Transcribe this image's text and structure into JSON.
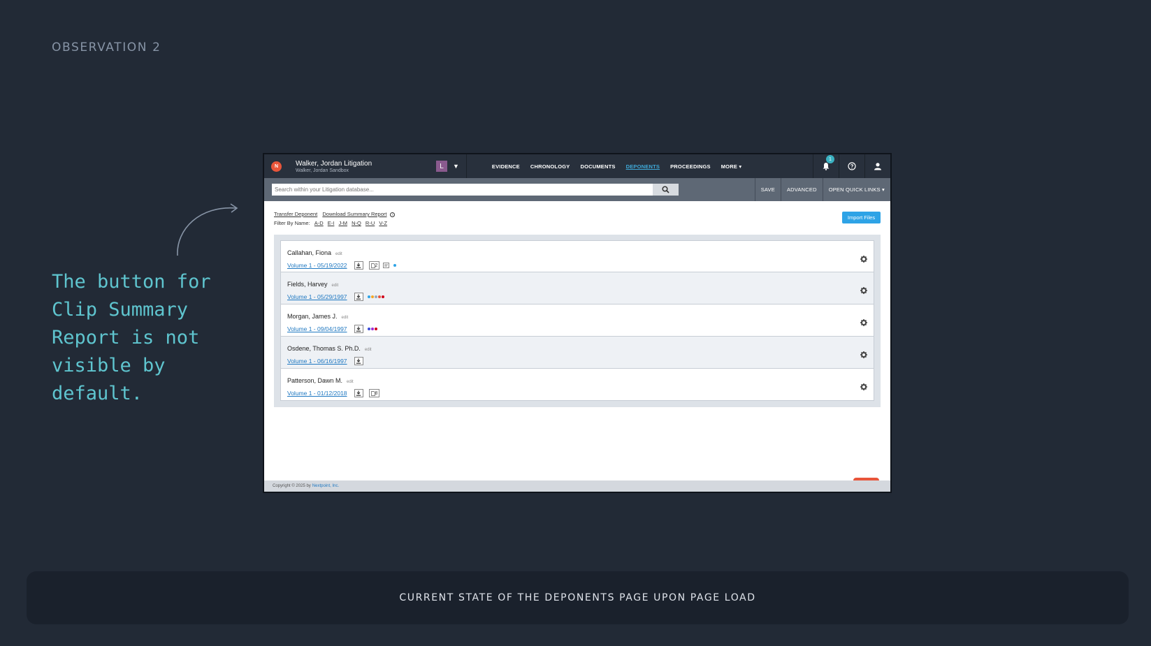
{
  "slide": {
    "observation_label": "OBSERVATION 2",
    "note": "The button for Clip Summary Report is not visible by default.",
    "caption": "CURRENT STATE OF THE DEPONENTS PAGE UPON PAGE LOAD"
  },
  "app": {
    "logo_text": "N",
    "case_title": "Walker, Jordan Litigation",
    "case_subtitle": "Walker, Jordan Sandbox",
    "badge": "L",
    "nav": [
      "EVIDENCE",
      "CHRONOLOGY",
      "DOCUMENTS",
      "DEPONENTS",
      "PROCEEDINGS",
      "MORE ▾"
    ],
    "active_nav": "DEPONENTS",
    "notification_count": "1",
    "search_placeholder": "Search within your Litigation database...",
    "search_actions": [
      "SAVE",
      "ADVANCED",
      "OPEN QUICK LINKS ▾"
    ],
    "links": {
      "transfer": "Transfer Deponent",
      "download": "Download Summary Report",
      "info": "i"
    },
    "filter": {
      "label": "Filter By Name:",
      "ranges": [
        "A-D",
        "E-I",
        "J-M",
        "N-Q",
        "R-U",
        "V-Z"
      ]
    },
    "import_button": "Import Files",
    "deponents": [
      {
        "name": "Callahan, Fiona",
        "edit": "edit",
        "volume": "Volume 1 - 05/19/2022",
        "exhibits": "2",
        "has_doc_icon": true,
        "dots": [
          "#2ea3e6"
        ]
      },
      {
        "name": "Fields, Harvey",
        "edit": "edit",
        "volume": "Volume 1 - 05/29/1997",
        "exhibits": "",
        "has_doc_icon": false,
        "dots": [
          "#2ea3e6",
          "#f5a623",
          "#9ab",
          "#e8553a",
          "#d0021b"
        ]
      },
      {
        "name": "Morgan, James J.",
        "edit": "edit",
        "volume": "Volume 1 - 09/04/1997",
        "exhibits": "",
        "has_doc_icon": false,
        "dots": [
          "#3b4bd8",
          "#9b2bd8",
          "#d0021b"
        ]
      },
      {
        "name": "Osdene, Thomas S. Ph.D.",
        "edit": "edit",
        "volume": "Volume 1 - 06/16/1997",
        "exhibits": "",
        "has_doc_icon": false,
        "dots": []
      },
      {
        "name": "Patterson, Dawn M.",
        "edit": "edit",
        "volume": "Volume 1 - 01/12/2018",
        "exhibits": "8",
        "has_doc_icon": false,
        "dots": []
      }
    ],
    "footer": {
      "text": "Copyright © 2025 by",
      "link": "Nextpoint, Inc."
    }
  }
}
